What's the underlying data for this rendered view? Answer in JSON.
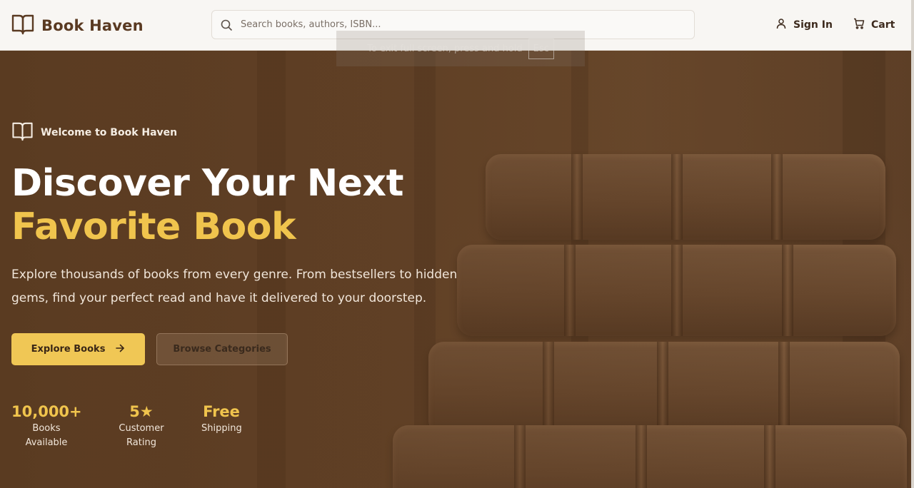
{
  "header": {
    "brand": "Book Haven",
    "search_placeholder": "Search books, authors, ISBN...",
    "sign_in": "Sign In",
    "cart": "Cart"
  },
  "fullscreen_notice": {
    "text": "To exit full screen, press and hold",
    "key": "Esc"
  },
  "hero": {
    "welcome": "Welcome to Book Haven",
    "headline_line1": "Discover Your Next",
    "headline_line2": "Favorite Book",
    "description": "Explore thousands of books from every genre. From bestsellers to hidden gems, find your perfect read and have it delivered to your doorstep.",
    "primary_button": "Explore Books",
    "secondary_button": "Browse Categories",
    "stats": [
      {
        "value": "10,000+",
        "label": "Books Available"
      },
      {
        "value": "5★",
        "label": "Customer Rating"
      },
      {
        "value": "Free",
        "label": "Shipping"
      }
    ]
  },
  "colors": {
    "brand": "#5a3a22",
    "accent": "#f0c44d",
    "hero_bg": "#644429"
  },
  "icons": [
    "book-open-icon",
    "search-icon",
    "user-icon",
    "cart-icon",
    "arrow-right-icon"
  ]
}
